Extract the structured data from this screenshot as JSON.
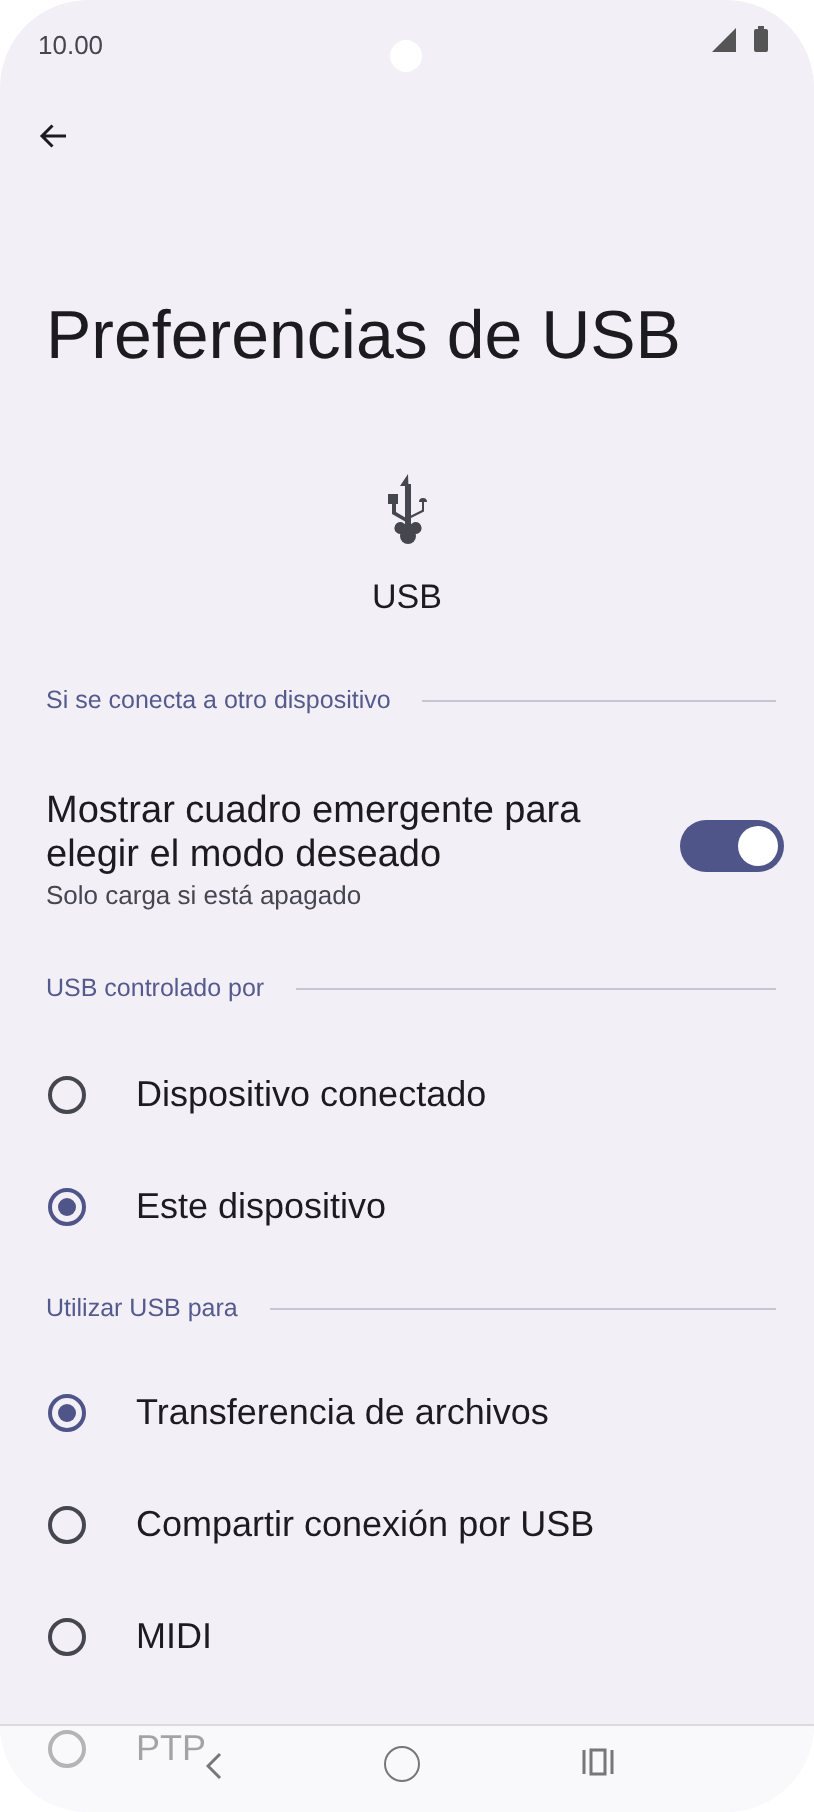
{
  "status_bar": {
    "time": "10.00"
  },
  "title": "Preferencias de USB",
  "usb_label": "USB",
  "sections": [
    {
      "header": "Si se conecta a otro dispositivo",
      "items": [
        {
          "kind": "toggle",
          "label": "Mostrar cuadro emergente para elegir el modo deseado",
          "subtitle": "Solo carga si está apagado",
          "on": true
        }
      ]
    },
    {
      "header": "USB controlado por",
      "items": [
        {
          "kind": "radio",
          "label": "Dispositivo conectado",
          "selected": false
        },
        {
          "kind": "radio",
          "label": "Este dispositivo",
          "selected": true
        }
      ]
    },
    {
      "header": "Utilizar USB para",
      "items": [
        {
          "kind": "radio",
          "label": "Transferencia de archivos",
          "selected": true
        },
        {
          "kind": "radio",
          "label": "Compartir conexión por USB",
          "selected": false
        },
        {
          "kind": "radio",
          "label": "MIDI",
          "selected": false
        },
        {
          "kind": "radio",
          "label": "PTP",
          "selected": false
        }
      ]
    }
  ]
}
